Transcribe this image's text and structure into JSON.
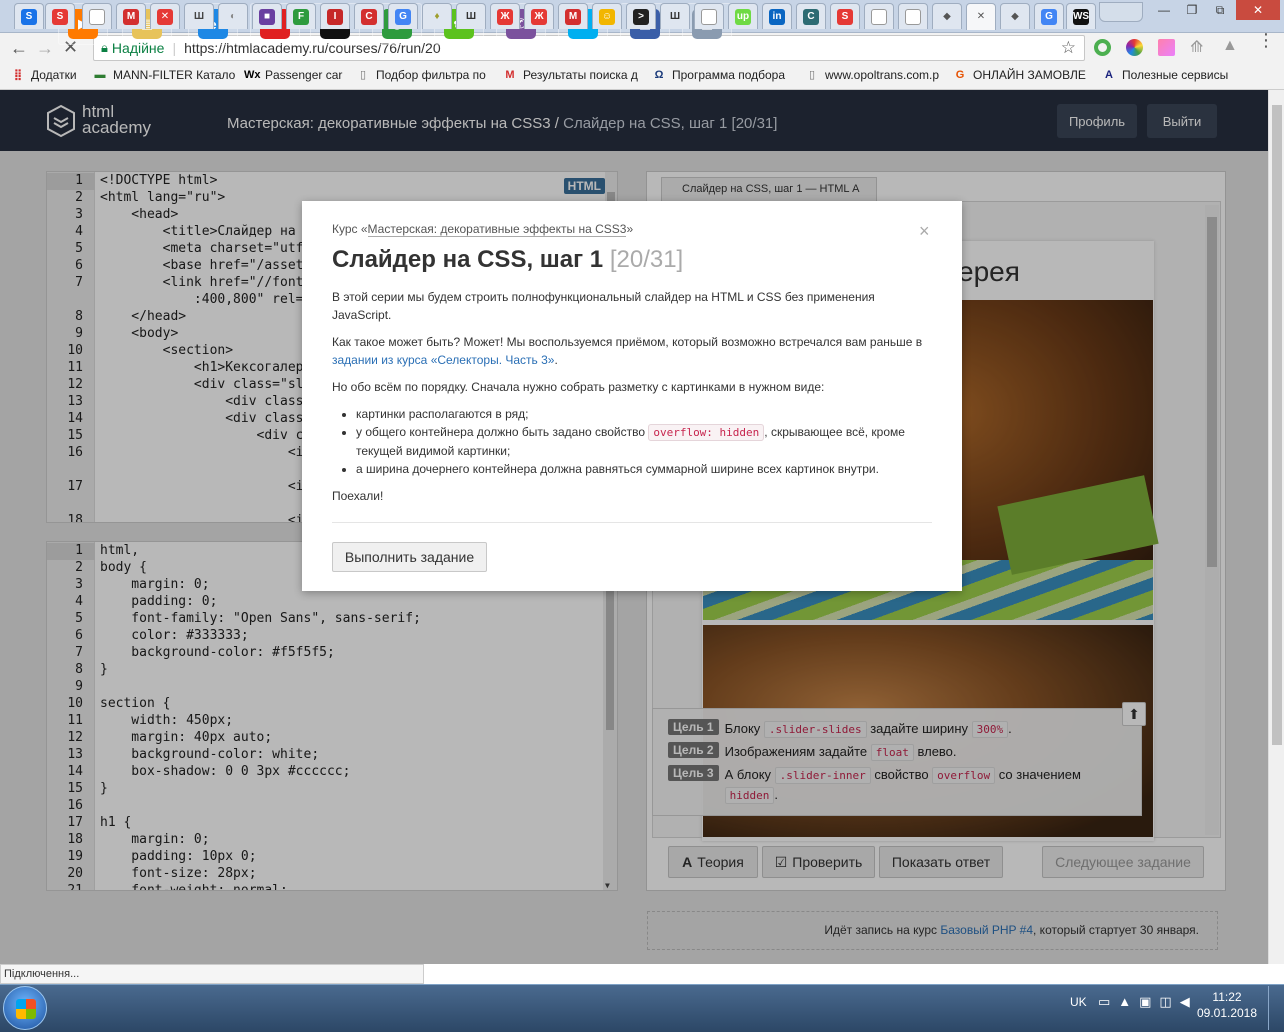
{
  "browser": {
    "status_text": "Підключення...",
    "secure_label": "Надійне",
    "url": "https://htmlacademy.ru/courses/76/run/20",
    "tabs": [
      {
        "icon": "s-icon",
        "color": "#1a73e8",
        "glyph": "S"
      },
      {
        "icon": "s-red-icon",
        "color": "#e53935",
        "glyph": "S"
      },
      {
        "icon": "page-icon",
        "color": "#ffffff",
        "glyph": ""
      },
      {
        "icon": "gmail-icon",
        "color": "#d32f2f",
        "glyph": "M"
      },
      {
        "icon": "x-icon",
        "color": "#e53935",
        "glyph": "✕"
      },
      {
        "icon": "building-icon",
        "color": "#444444",
        "glyph": "Ш"
      },
      {
        "icon": "leaf-icon",
        "color": "#888888",
        "glyph": "◐"
      },
      {
        "icon": "square-icon",
        "color": "#6a3fa0",
        "glyph": "■"
      },
      {
        "icon": "f-icon",
        "color": "#2e9b3e",
        "glyph": "F"
      },
      {
        "icon": "thermometer-icon",
        "color": "#c62828",
        "glyph": "I"
      },
      {
        "icon": "circle-c-icon",
        "color": "#d32f2f",
        "glyph": "C"
      },
      {
        "icon": "translate-icon",
        "color": "#4285f4",
        "glyph": "G"
      },
      {
        "icon": "bulb-icon",
        "color": "#9e9e2e",
        "glyph": "♦"
      },
      {
        "icon": "building-icon",
        "color": "#333333",
        "glyph": "Ш"
      },
      {
        "icon": "tower-icon",
        "color": "#e53935",
        "glyph": "Ж"
      },
      {
        "icon": "tower-icon",
        "color": "#e53935",
        "glyph": "Ж"
      },
      {
        "icon": "gmail-icon",
        "color": "#d32f2f",
        "glyph": "M"
      },
      {
        "icon": "smile-icon",
        "color": "#f2b600",
        "glyph": "☺"
      },
      {
        "icon": "terminal-icon",
        "color": "#222222",
        "glyph": ">"
      },
      {
        "icon": "building-icon",
        "color": "#333333",
        "glyph": "Ш"
      },
      {
        "icon": "page-icon",
        "color": "#ffffff",
        "glyph": ""
      },
      {
        "icon": "upwork-icon",
        "color": "#6fda44",
        "glyph": "up"
      },
      {
        "icon": "linkedin-icon",
        "color": "#0a66c2",
        "glyph": "in"
      },
      {
        "icon": "c-icon",
        "color": "#2d6b73",
        "glyph": "C"
      },
      {
        "icon": "s-red-icon",
        "color": "#e53935",
        "glyph": "S"
      },
      {
        "icon": "page-icon",
        "color": "#ffffff",
        "glyph": ""
      },
      {
        "icon": "page-icon",
        "color": "#ffffff",
        "glyph": ""
      },
      {
        "icon": "shield-icon",
        "color": "#555555",
        "glyph": "◆"
      },
      {
        "icon": "close-icon",
        "color": "#555555",
        "glyph": "✕"
      },
      {
        "icon": "shield-icon",
        "color": "#555555",
        "glyph": "◆"
      },
      {
        "icon": "google-icon",
        "color": "#4285f4",
        "glyph": "G"
      },
      {
        "icon": "webstorm-icon",
        "color": "#111111",
        "glyph": "WS"
      }
    ],
    "bookmarks": [
      {
        "label": "Додатки",
        "icon": "apps-icon",
        "color": "#d32f2f"
      },
      {
        "label": "MANN-FILTER Катало",
        "icon": "mann-icon",
        "color": "#2e7d32"
      },
      {
        "label": "Passenger car",
        "icon": "wix-icon",
        "color": "#000000"
      },
      {
        "label": "Подбор фильтра по",
        "icon": "page-icon",
        "color": "#777777"
      },
      {
        "label": "Результаты поиска д",
        "icon": "m-icon",
        "color": "#d32f2f"
      },
      {
        "label": "Программа подбора",
        "icon": "omega-icon",
        "color": "#1a3a7a"
      },
      {
        "label": "www.opoltrans.com.p",
        "icon": "page-icon",
        "color": "#777777"
      },
      {
        "label": "ОНЛАЙН ЗАМОВЛЕ",
        "icon": "g-icon",
        "color": "#e65100"
      },
      {
        "label": "Полезные сервисы",
        "icon": "a-icon",
        "color": "#1a237e"
      }
    ]
  },
  "site": {
    "logo_line1": "html",
    "logo_line2": "academy",
    "course_title": "Мастерская: декоративные эффекты на CSS3 /",
    "step_title": "Слайдер на CSS, шаг 1",
    "step_counter": "[20/31]",
    "profile_button": "Профиль",
    "logout_button": "Выйти"
  },
  "html_editor": {
    "badge": "HTML",
    "line_numbers": [
      "1",
      "2",
      "3",
      "4",
      "5",
      "6",
      "7",
      "",
      "8",
      "9",
      "10",
      "11",
      "12",
      "13",
      "14",
      "15",
      "16",
      "",
      "17",
      "",
      "18"
    ],
    "lines": [
      "<!DOCTYPE html>",
      "<html lang=\"ru\">",
      "    <head>",
      "        <title>Слайдер на С",
      "        <meta charset=\"utf",
      "        <base href=\"/assets",
      "        <link href=\"//fonts",
      "            :400,800\" rel=\"",
      "    </head>",
      "    <body>",
      "        <section>",
      "            <h1>Кексогалере",
      "            <div class=\"sli",
      "                <div class",
      "                <div class",
      "                    <div c",
      "                        <i",
      "",
      "                        <i",
      "",
      "                        <i"
    ]
  },
  "css_editor": {
    "line_numbers": [
      "1",
      "2",
      "3",
      "4",
      "5",
      "6",
      "7",
      "8",
      "9",
      "10",
      "11",
      "12",
      "13",
      "14",
      "15",
      "16",
      "17",
      "18",
      "19",
      "20",
      "21"
    ],
    "lines": [
      "html,",
      "body {",
      "    margin: 0;",
      "    padding: 0;",
      "    font-family: \"Open Sans\", sans-serif;",
      "    color: #333333;",
      "    background-color: #f5f5f5;",
      "}",
      "",
      "section {",
      "    width: 450px;",
      "    margin: 40px auto;",
      "    background-color: white;",
      "    box-shadow: 0 0 3px #cccccc;",
      "}",
      "",
      "h1 {",
      "    margin: 0;",
      "    padding: 10px 0;",
      "    font-size: 28px;",
      "    font-weight: normal;"
    ]
  },
  "preview": {
    "tab_label": "Слайдер на CSS, шаг 1 — HTML А",
    "heading_fragment": "ерея",
    "goals": [
      {
        "badge": "Цель 1",
        "parts": [
          "Блоку ",
          ".slider-slides",
          " задайте ширину ",
          "300%",
          "."
        ]
      },
      {
        "badge": "Цель 2",
        "parts": [
          "Изображениям задайте ",
          "float",
          " влево."
        ]
      },
      {
        "badge": "Цель 3",
        "parts": [
          "А блоку ",
          ".slider-inner",
          " свойство ",
          "overflow",
          " со значением ",
          "hidden",
          "."
        ]
      }
    ],
    "buttons": {
      "theory": "Теория",
      "check": "Проверить",
      "show_answer": "Показать ответ",
      "next_task": "Следующее задание"
    },
    "promo_prefix": "Идёт запись на курс ",
    "promo_link": "Базовый PHP #4",
    "promo_suffix": ", который стартует 30 января."
  },
  "modal": {
    "course_prefix": "Курс «",
    "course_link": "Мастерская: декоративные эффекты на CSS3",
    "course_suffix": "»",
    "title": "Слайдер на CSS, шаг 1",
    "counter": "[20/31]",
    "close": "×",
    "p1": "В этой серии мы будем строить полнофункциональный слайдер на HTML и CSS без применения JavaScript.",
    "p2_prefix": "Как такое может быть? Может! Мы воспользуемся приёмом, который возможно встречался вам раньше в ",
    "p2_link": "задании из курса «Селекторы. Часть 3»",
    "p2_suffix": ".",
    "p3": "Но обо всём по порядку. Сначала нужно собрать разметку с картинками в нужном виде:",
    "li1": "картинки располагаются в ряд;",
    "li2_prefix": "у общего контейнера должно быть задано свойство ",
    "li2_code": "overflow: hidden",
    "li2_suffix": ", скрывающее всё, кроме текущей видимой картинки;",
    "li3": "а ширина дочернего контейнера должна равняться суммарной ширине всех картинок внутри.",
    "p4": "Поехали!",
    "button": "Выполнить задание"
  },
  "taskbar": {
    "lang": "UK",
    "time": "11:22",
    "date": "09.01.2018",
    "apps": [
      {
        "icon": "media-player-icon",
        "color": "#ff7a00",
        "glyph": "▶"
      },
      {
        "icon": "folder-icon",
        "color": "#e7c35a",
        "glyph": "▤"
      },
      {
        "icon": "internet-explorer-icon",
        "color": "#1e88e5",
        "glyph": "e"
      },
      {
        "icon": "opera-icon",
        "color": "#e02020",
        "glyph": "O"
      },
      {
        "icon": "webstorm-icon",
        "color": "#111111",
        "glyph": "WS"
      },
      {
        "icon": "chrome-icon",
        "color": "#2e9b3e",
        "glyph": "◉"
      },
      {
        "icon": "icq-icon",
        "color": "#5cc21e",
        "glyph": "✿"
      },
      {
        "icon": "viber-icon",
        "color": "#7b519d",
        "glyph": "✆"
      },
      {
        "icon": "skype-icon",
        "color": "#00aff0",
        "glyph": "S"
      },
      {
        "icon": "remote-desktop-icon",
        "color": "#3a5ea8",
        "glyph": "▣"
      },
      {
        "icon": "calculator-icon",
        "color": "#8a9bb0",
        "glyph": "▦"
      }
    ]
  }
}
